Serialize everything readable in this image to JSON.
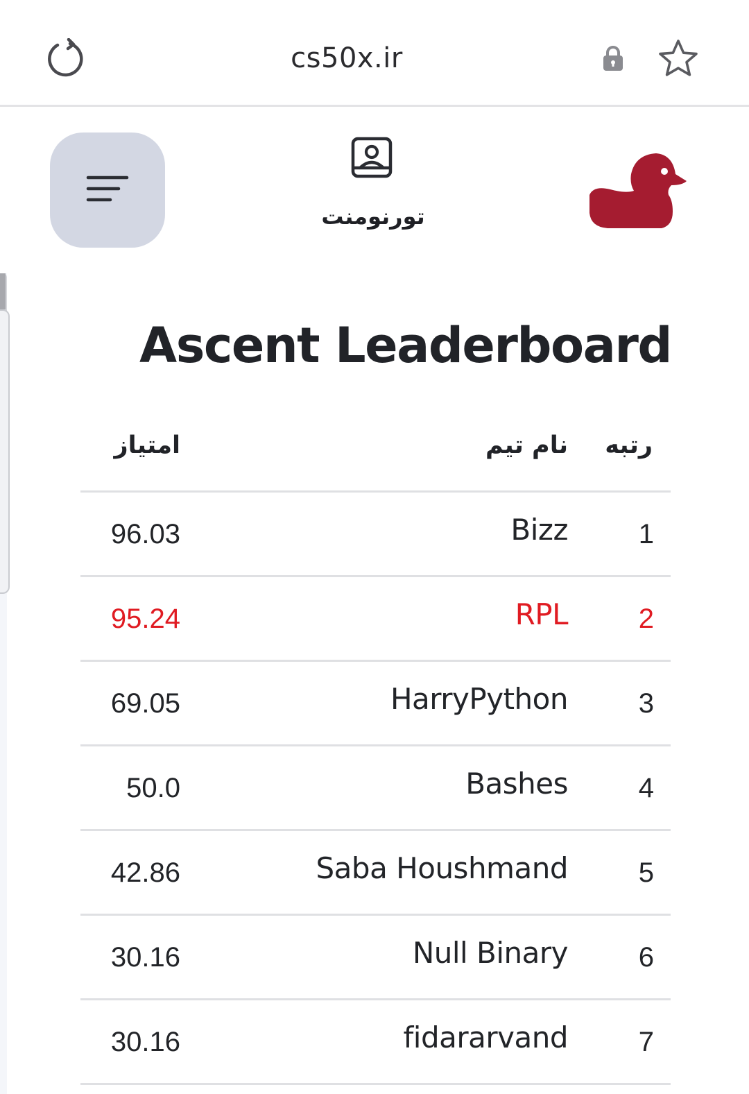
{
  "browser": {
    "url": "cs50x.ir",
    "reload_icon": "reload-icon",
    "lock_icon": "lock-icon",
    "bookmark_icon": "star-icon"
  },
  "header": {
    "menu_icon": "menu-icon",
    "tournament_label": "تورنومنت",
    "tournament_icon": "user-badge-icon",
    "logo": "duck-logo",
    "logo_color": "#a51c30"
  },
  "leaderboard": {
    "title": "Ascent Leaderboard",
    "columns": {
      "rank": "رتبه",
      "team": "نام تیم",
      "score": "امتیاز"
    },
    "highlight_color": "#e01b22",
    "rows": [
      {
        "rank": "1",
        "team": "Bizz",
        "score": "96.03",
        "highlighted": false
      },
      {
        "rank": "2",
        "team": "RPL",
        "score": "95.24",
        "highlighted": true
      },
      {
        "rank": "3",
        "team": "HarryPython",
        "score": "69.05",
        "highlighted": false
      },
      {
        "rank": "4",
        "team": "Bashes",
        "score": "50.0",
        "highlighted": false
      },
      {
        "rank": "5",
        "team": "Saba Houshmand",
        "score": "42.86",
        "highlighted": false
      },
      {
        "rank": "6",
        "team": "Null Binary",
        "score": "30.16",
        "highlighted": false
      },
      {
        "rank": "7",
        "team": "fidararvand",
        "score": "30.16",
        "highlighted": false
      }
    ]
  }
}
